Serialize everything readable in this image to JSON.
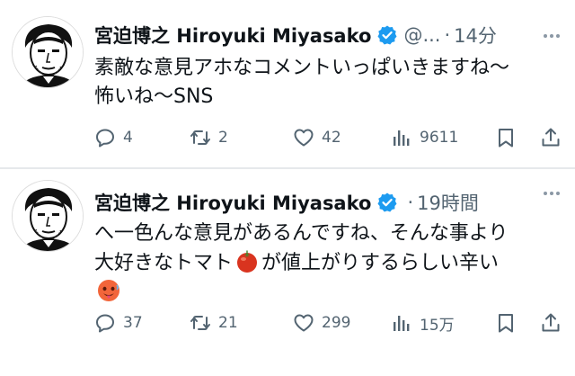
{
  "tweets": [
    {
      "author_name": "宮迫博之 Hiroyuki Miyasako",
      "handle": "@...",
      "time": "14分",
      "text_lines": [
        "素敵な意見アホなコメントいっぱいきますね〜",
        "怖いね〜SNS"
      ],
      "replies": "4",
      "retweets": "2",
      "likes": "42",
      "views": "9611"
    },
    {
      "author_name": "宮迫博之 Hiroyuki Miyasako",
      "handle": "",
      "time": "19時間",
      "text_lines": [
        "へ一色んな意見があるんですね、そんな事より",
        "大好きなトマト",
        "が値上がりするらしい辛い"
      ],
      "replies": "37",
      "retweets": "21",
      "likes": "299",
      "views": "15万"
    }
  ],
  "icons": {
    "verified": "verified-badge-icon",
    "more": "more-dots-icon",
    "reply": "reply-icon",
    "retweet": "retweet-icon",
    "like": "heart-icon",
    "views": "views-chart-icon",
    "bookmark": "bookmark-icon",
    "share": "share-icon",
    "tomato": "tomato-emoji",
    "hot_face": "hot-face-emoji"
  },
  "colors": {
    "verified": "#1d9bf0",
    "secondary": "#536471",
    "text": "#0f1419"
  }
}
